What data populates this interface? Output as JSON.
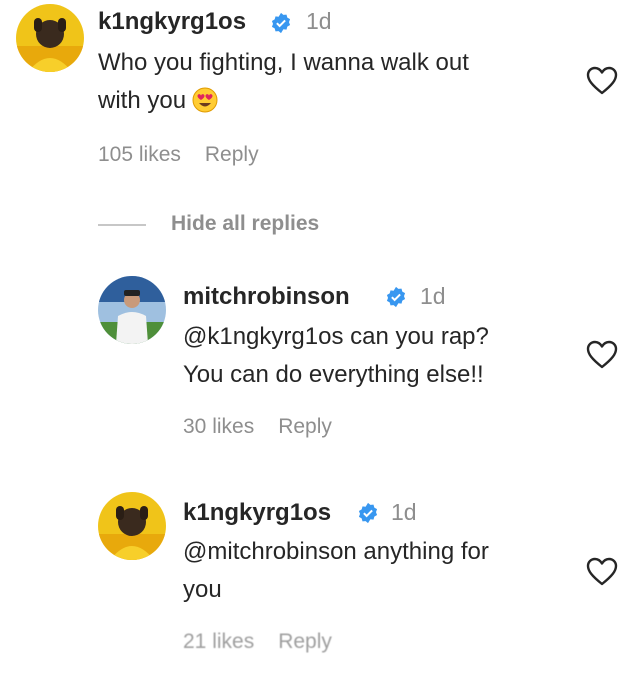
{
  "comments": [
    {
      "username": "k1ngkyrg1os",
      "time": "1d",
      "text_line1": "Who you fighting, I wanna walk out",
      "text_line2": "with you",
      "emoji": "heart-eyes-emoji",
      "likes": "105 likes",
      "reply": "Reply"
    }
  ],
  "replies_toggle": "Hide all replies",
  "replies": [
    {
      "username": "mitchrobinson",
      "time": "1d",
      "text_line1": "@k1ngkyrg1os can you rap?",
      "text_line2": "You can do everything else!!",
      "likes": "30 likes",
      "reply": "Reply"
    },
    {
      "username": "k1ngkyrg1os",
      "time": "1d",
      "text_line1": "@mitchrobinson anything for",
      "text_line2": "you",
      "likes": "2​1 likes",
      "reply": "Reply"
    }
  ],
  "colors": {
    "verified": "#3897f0",
    "secondary_text": "#8e8e8e",
    "primary_text": "#262626"
  }
}
